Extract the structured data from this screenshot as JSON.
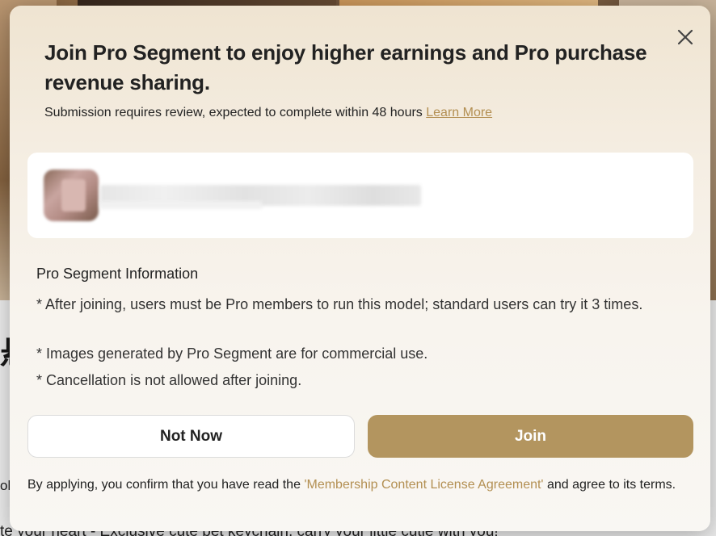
{
  "background": {
    "char": "悬",
    "partial_text": "ol",
    "caption": "te your heart - Exclusive cute pet keychain, carry your little cutie with you!"
  },
  "modal": {
    "title": "Join Pro Segment to enjoy higher earnings and Pro purchase revenue sharing.",
    "subtitle": "Submission requires review, expected to complete within 48 hours",
    "learn_more": "Learn More",
    "section_title": "Pro Segment Information",
    "info": [
      "* After joining, users must be Pro members to run this model; standard users can try it 3 times.",
      "* Images generated by Pro Segment are for commercial use.",
      "* Cancellation is not allowed after joining."
    ],
    "buttons": {
      "not_now": "Not Now",
      "join": "Join"
    },
    "terms": {
      "prefix": "By applying, you confirm that you have read the",
      "link": "'Membership Content License Agreement'",
      "suffix": "and agree to its terms."
    }
  },
  "colors": {
    "accent": "#b3955f",
    "link": "#b38f52"
  },
  "icons": {
    "close": "close-icon"
  }
}
